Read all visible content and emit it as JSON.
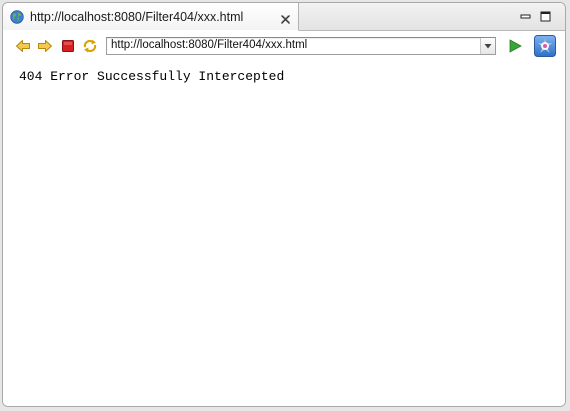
{
  "tab": {
    "title": "http://localhost:8080/Filter404/xxx.html"
  },
  "toolbar": {
    "address_value": "http://localhost:8080/Filter404/xxx.html",
    "icons": [
      "back-arrow-icon",
      "forward-arrow-icon",
      "stop-icon",
      "refresh-icon",
      "go-icon",
      "web-services-icon"
    ]
  },
  "page": {
    "message": "404 Error Successfully Intercepted"
  },
  "colors": {
    "arrow_fill": "#f2c94c",
    "stop_fill": "#d62020",
    "go_fill": "#3aa63a"
  }
}
